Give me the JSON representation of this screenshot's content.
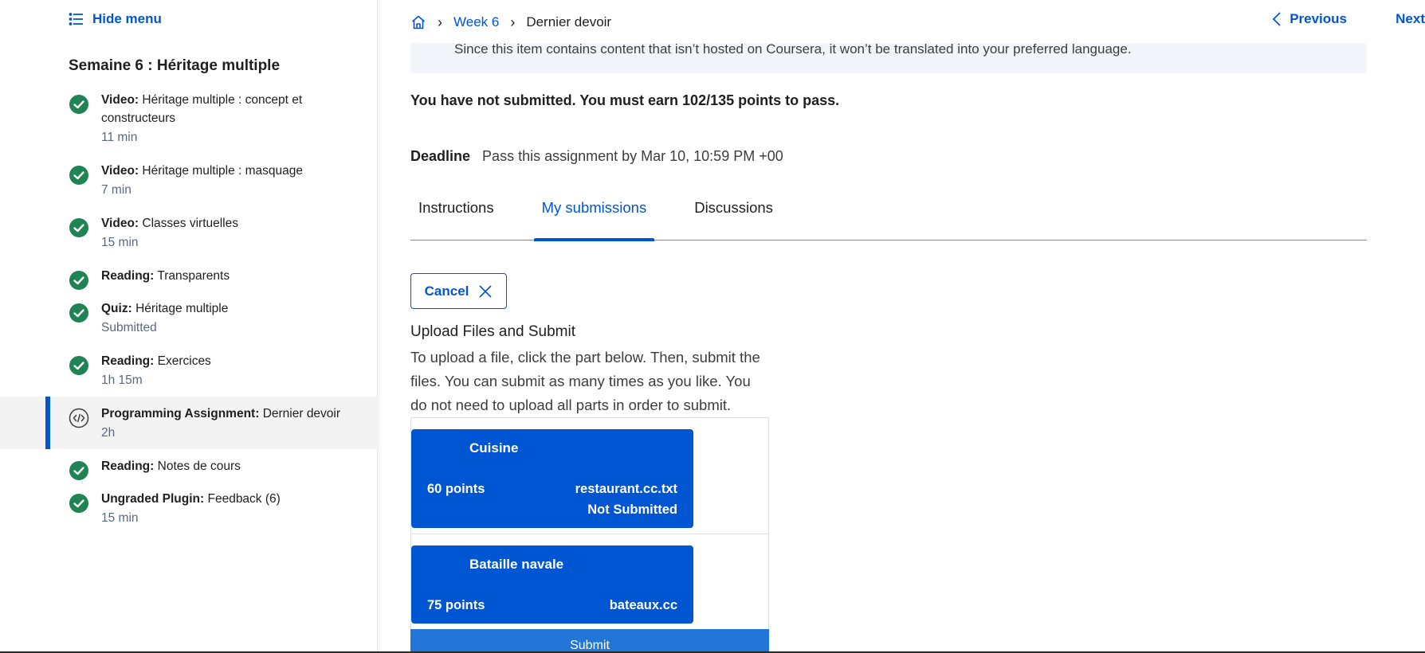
{
  "sidebar": {
    "hide_menu_label": "Hide menu",
    "week_title": "Semaine 6 : Héritage multiple",
    "items": [
      {
        "type": "Video:",
        "title": "Héritage multiple : concept et constructeurs",
        "meta": "11 min",
        "status": "completed"
      },
      {
        "type": "Video:",
        "title": "Héritage multiple : masquage",
        "meta": "7 min",
        "status": "completed"
      },
      {
        "type": "Video:",
        "title": "Classes virtuelles",
        "meta": "15 min",
        "status": "completed"
      },
      {
        "type": "Reading:",
        "title": "Transparents",
        "meta": "",
        "status": "completed"
      },
      {
        "type": "Quiz:",
        "title": "Héritage multiple",
        "meta": "Submitted",
        "status": "completed"
      },
      {
        "type": "Reading:",
        "title": "Exercices",
        "meta": "1h 15m",
        "status": "completed"
      },
      {
        "type": "Programming Assignment:",
        "title": "Dernier devoir",
        "meta": "2h",
        "status": "current"
      },
      {
        "type": "Reading:",
        "title": "Notes de cours",
        "meta": "",
        "status": "completed"
      },
      {
        "type": "Ungraded Plugin:",
        "title": "Feedback (6)",
        "meta": "15 min",
        "status": "completed"
      }
    ]
  },
  "breadcrumb": {
    "week": "Week 6",
    "current": "Dernier devoir"
  },
  "nav": {
    "previous": "Previous",
    "next": "Next"
  },
  "notice": "Since this item contains content that isn’t hosted on Coursera, it won’t be translated into your preferred language.",
  "status_line": "You have not submitted. You must earn 102/135 points to pass.",
  "deadline": {
    "label": "Deadline",
    "value": "Pass this assignment by Mar 10, 10:59 PM +00"
  },
  "tabs": [
    "Instructions",
    "My submissions",
    "Discussions"
  ],
  "cancel_label": "Cancel",
  "upload": {
    "title": "Upload Files and Submit",
    "description": "To upload a file, click the part below. Then, submit the files. You can submit as many times as you like. You do not need to upload all parts in order to submit."
  },
  "parts": [
    {
      "name": "Cuisine",
      "points": "60 points",
      "file": "restaurant.cc.txt",
      "status": "Not Submitted"
    },
    {
      "name": "Bataille navale",
      "points": "75 points",
      "file": "bateaux.cc",
      "status": ""
    }
  ],
  "submit_label": "Submit",
  "colors": {
    "accent": "#0056d2",
    "success": "#1f8354",
    "submit": "#2176d8"
  }
}
